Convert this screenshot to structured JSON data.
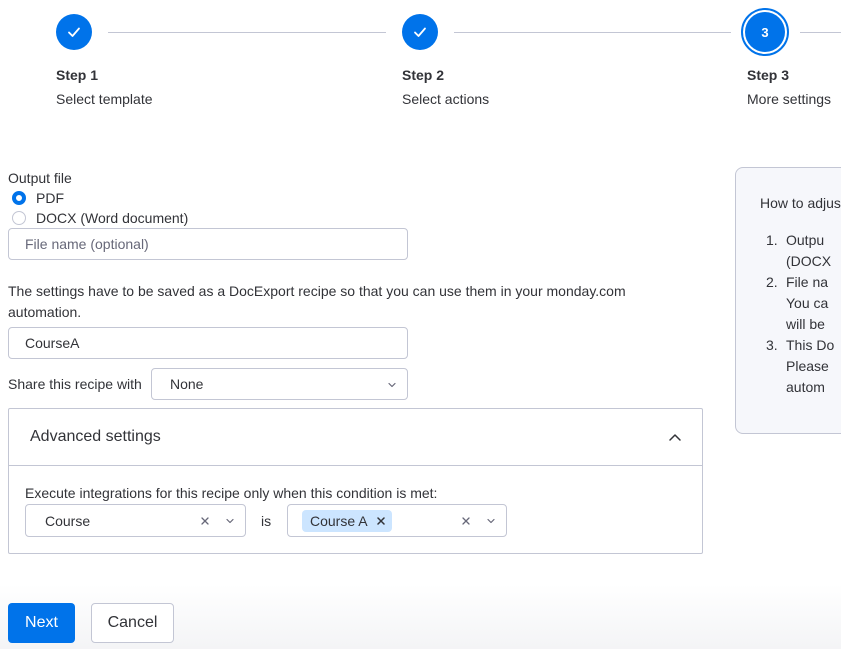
{
  "stepper": {
    "steps": [
      {
        "title": "Step 1",
        "subtitle": "Select template",
        "state": "done"
      },
      {
        "title": "Step 2",
        "subtitle": "Select actions",
        "state": "done"
      },
      {
        "title": "Step 3",
        "subtitle": "More settings",
        "state": "current",
        "number": "3"
      }
    ]
  },
  "output_file": {
    "label": "Output file",
    "options": [
      {
        "label": "PDF",
        "selected": true
      },
      {
        "label": "DOCX (Word document)",
        "selected": false
      }
    ],
    "file_name_value": "",
    "file_name_placeholder": "File name (optional)"
  },
  "recipe": {
    "note": "The settings have to be saved as a DocExport recipe so that you can use them in your monday.com automation.",
    "name_value": "CourseA",
    "share_label": "Share this recipe with",
    "share_value": "None"
  },
  "advanced": {
    "title": "Advanced settings",
    "condition_label": "Execute integrations for this recipe only when this condition is met:",
    "column_value": "Course",
    "operator": "is",
    "chip_value": "Course A"
  },
  "buttons": {
    "next": "Next",
    "cancel": "Cancel"
  },
  "help": {
    "intro": "How to adjus",
    "items": [
      {
        "num": "1.",
        "lines": [
          "Outpu",
          "(DOCX"
        ]
      },
      {
        "num": "2.",
        "lines": [
          "File na",
          "You ca",
          "will be"
        ]
      },
      {
        "num": "3.",
        "lines": [
          "This Do",
          "Please",
          "autom"
        ]
      }
    ]
  },
  "colors": {
    "primary": "#0073ea",
    "border": "#c3c6d4",
    "text": "#323338",
    "chip": "#cce5ff"
  }
}
